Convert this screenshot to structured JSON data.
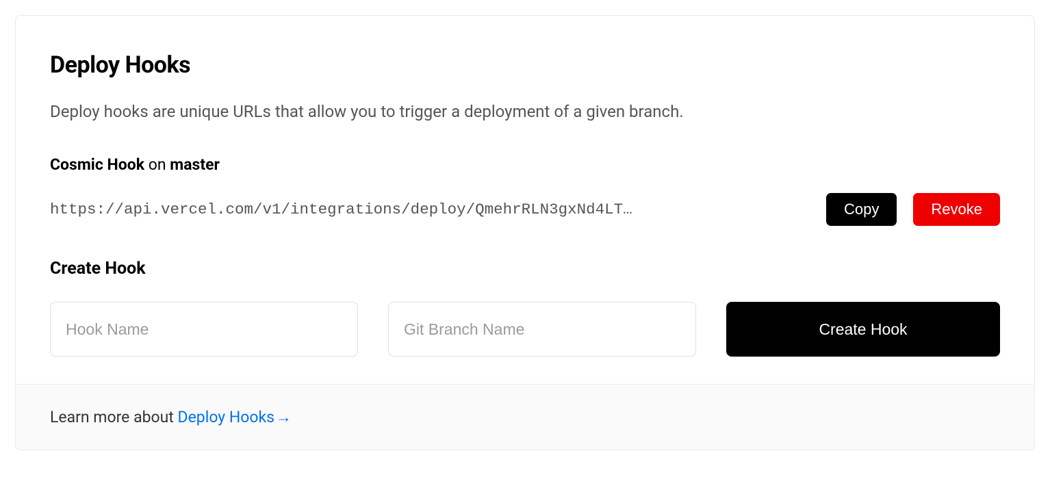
{
  "header": {
    "title": "Deploy Hooks",
    "description": "Deploy hooks are unique URLs that allow you to trigger a deployment of a given branch."
  },
  "hook": {
    "name": "Cosmic Hook",
    "on_text": " on ",
    "branch": "master",
    "url": "https://api.vercel.com/v1/integrations/deploy/QmehrRLN3gxNd4LT…",
    "copy_label": "Copy",
    "revoke_label": "Revoke"
  },
  "create": {
    "heading": "Create Hook",
    "name_placeholder": "Hook Name",
    "branch_placeholder": "Git Branch Name",
    "button_label": "Create Hook"
  },
  "footer": {
    "prefix": "Learn more about ",
    "link_text": "Deploy Hooks",
    "arrow": " →"
  }
}
